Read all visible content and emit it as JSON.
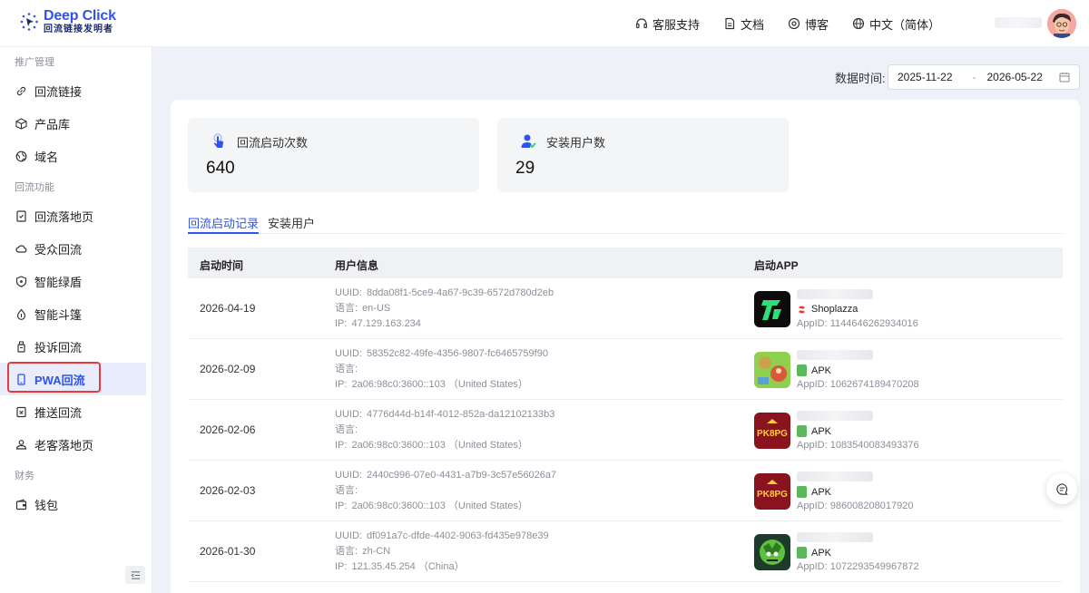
{
  "logo": {
    "title": "Deep Click",
    "subtitle": "回流链接发明者"
  },
  "topnav": [
    {
      "label": "客服支持",
      "icon": "headset-icon"
    },
    {
      "label": "文档",
      "icon": "document-icon"
    },
    {
      "label": "博客",
      "icon": "blog-icon"
    },
    {
      "label": "中文（简体）",
      "icon": "globe-icon"
    }
  ],
  "sidebar": {
    "groups": [
      {
        "label": "推广管理",
        "items": [
          {
            "label": "回流链接",
            "icon": "link-icon"
          },
          {
            "label": "产品库",
            "icon": "cube-icon"
          },
          {
            "label": "域名",
            "icon": "globe-icon"
          }
        ]
      },
      {
        "label": "回流功能",
        "items": [
          {
            "label": "回流落地页",
            "icon": "page-icon"
          },
          {
            "label": "受众回流",
            "icon": "cloud-icon"
          },
          {
            "label": "智能绿盾",
            "icon": "shield-icon"
          },
          {
            "label": "智能斗篷",
            "icon": "drop-icon"
          },
          {
            "label": "投诉回流",
            "icon": "bottle-icon"
          },
          {
            "label": "PWA回流",
            "icon": "phone-icon",
            "active": true
          },
          {
            "label": "推送回流",
            "icon": "push-icon"
          },
          {
            "label": "老客落地页",
            "icon": "user-icon"
          }
        ]
      },
      {
        "label": "财务",
        "items": [
          {
            "label": "钱包",
            "icon": "wallet-icon"
          }
        ]
      }
    ]
  },
  "date_filter": {
    "label": "数据时间:",
    "start": "2025-11-22",
    "separator": "-",
    "end": "2026-05-22"
  },
  "stats": [
    {
      "label": "回流启动次数",
      "value": "640",
      "icon": "tap-icon"
    },
    {
      "label": "安装用户数",
      "value": "29",
      "icon": "user-check-icon"
    }
  ],
  "tabs": [
    {
      "label": "回流启动记录",
      "active": true
    },
    {
      "label": "安装用户",
      "active": false
    }
  ],
  "table": {
    "columns": [
      "启动时间",
      "用户信息",
      "启动APP"
    ],
    "labels": {
      "uuid": "UUID:",
      "lang": "语言:",
      "ip": "IP:",
      "appid": "AppID:"
    },
    "rows": [
      {
        "date": "2026-04-19",
        "uuid": "8dda08f1-5ce9-4a67-9c39-6572d780d2eb",
        "lang": "en-US",
        "ip": "47.129.163.234",
        "app_type": "Shoplazza",
        "app_id": "1144646262934016",
        "app_icon": "rt-app-icon"
      },
      {
        "date": "2026-02-09",
        "uuid": "58352c82-49fe-4356-9807-fc6465759f90",
        "lang": "",
        "ip": "2a06:98c0:3600::103 （United States）",
        "app_type": "APK",
        "app_id": "1062674189470208",
        "app_icon": "game-app-icon"
      },
      {
        "date": "2026-02-06",
        "uuid": "4776d44d-b14f-4012-852a-da12102133b3",
        "lang": "",
        "ip": "2a06:98c0:3600::103 （United States）",
        "app_type": "APK",
        "app_id": "1083540083493376",
        "app_icon": "pk8pg-app-icon"
      },
      {
        "date": "2026-02-03",
        "uuid": "2440c996-07e0-4431-a7b9-3c57e56026a7",
        "lang": "",
        "ip": "2a06:98c0:3600::103 （United States）",
        "app_type": "APK",
        "app_id": "986008208017920",
        "app_icon": "pk8pg-app-icon"
      },
      {
        "date": "2026-01-30",
        "uuid": "df091a7c-dfde-4402-9063-fd435e978e39",
        "lang": "zh-CN",
        "ip": "121.35.45.254 （China）",
        "app_type": "APK",
        "app_id": "1072293549967872",
        "app_icon": "zombie-app-icon"
      }
    ]
  },
  "colors": {
    "accent": "#2f54eb",
    "highlight_border": "#e8393e",
    "apk_badge": "#5cb85c",
    "shoplazza": "#e8393e"
  }
}
